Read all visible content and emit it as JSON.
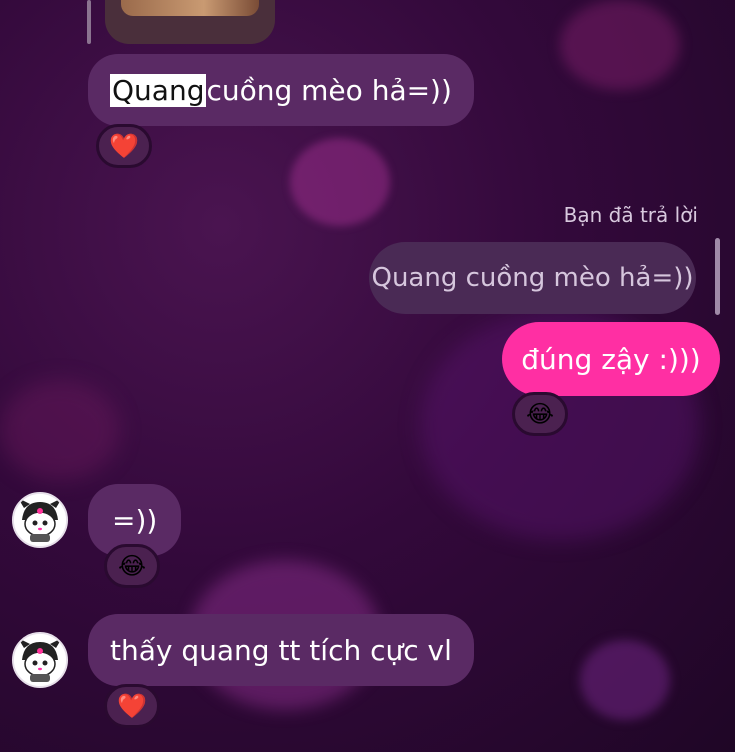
{
  "messages": [
    {
      "id": "m1",
      "direction": "incoming",
      "highlighted_word": "Quang",
      "rest_text": " cuồng mèo hả=))",
      "reaction": "❤️"
    },
    {
      "id": "m2",
      "direction": "outgoing",
      "reply_label": "Bạn đã trả lời",
      "quoted_text": "Quang cuồng mèo hả=))",
      "text": "đúng zậy :)))",
      "reaction": "😂"
    },
    {
      "id": "m3",
      "direction": "incoming",
      "text": "=))",
      "reaction": "😂",
      "avatar_icon": "kuromi-avatar-icon"
    },
    {
      "id": "m4",
      "direction": "incoming",
      "text": "thấy quang tt tích cực vl",
      "reaction": "❤️",
      "avatar_icon": "kuromi-avatar-icon"
    }
  ],
  "colors": {
    "background_top": "#4a1450",
    "background_bottom": "#1f0626",
    "incoming_bubble": "#5a2a64",
    "outgoing_bubble": "#ff2fa3",
    "quoted_bubble": "#4a2a55"
  }
}
